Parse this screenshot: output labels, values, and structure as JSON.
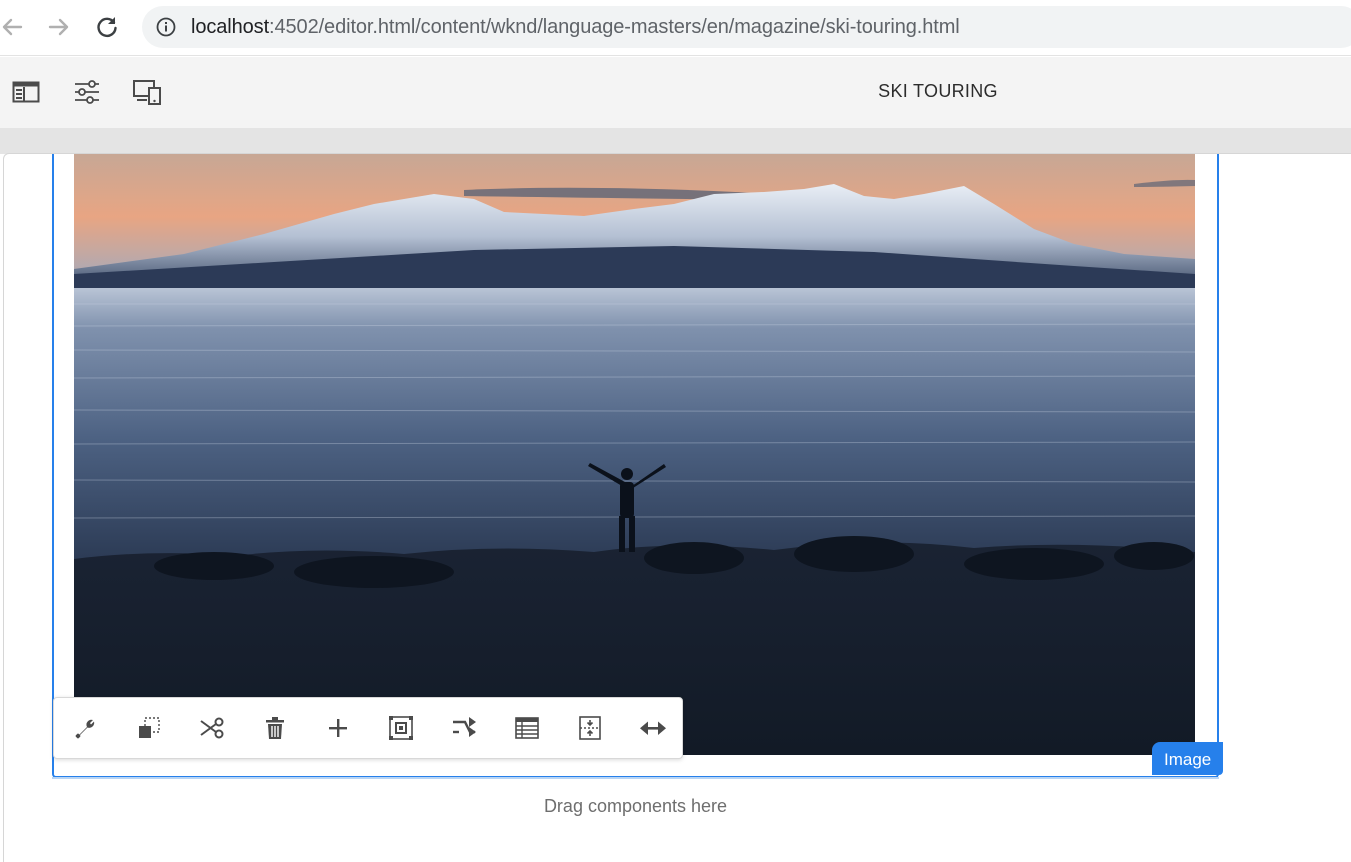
{
  "browser": {
    "url_host": "localhost",
    "url_rest": ":4502/editor.html/content/wknd/language-masters/en/magazine/ski-touring.html"
  },
  "editor": {
    "page_title": "SKI TOURING",
    "icons": [
      "side-panel-icon",
      "page-properties-icon",
      "emulator-icon"
    ]
  },
  "component": {
    "badge_label": "Image",
    "toolbar_icons": [
      "configure-icon",
      "copy-icon",
      "cut-icon",
      "delete-icon",
      "insert-icon",
      "group-icon",
      "convert-icon",
      "style-icon",
      "layout-icon",
      "resize-icon"
    ]
  },
  "drop_zone": {
    "label": "Drag components here"
  },
  "colors": {
    "accent": "#2680eb",
    "toolbar_bg": "#f4f4f4"
  }
}
